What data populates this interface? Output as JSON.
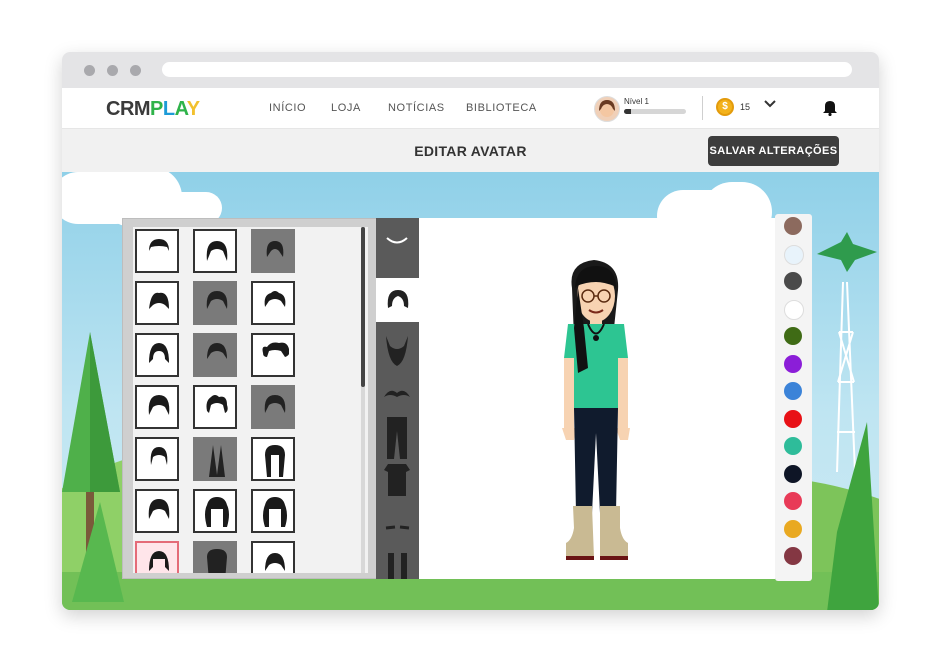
{
  "header": {
    "logo": {
      "crm": "CRM",
      "play_p": "P",
      "play_l": "L",
      "play_a": "A",
      "play_y": "Y"
    },
    "nav": [
      {
        "label": "INÍCIO"
      },
      {
        "label": "LOJA"
      },
      {
        "label": "NOTÍCIAS"
      },
      {
        "label": "BIBLIOTECA"
      }
    ],
    "level": {
      "label": "Nível 1",
      "progress": 0.12
    },
    "coins": "15",
    "icons": {
      "dropdown": "chevron-down-icon",
      "notifications": "bell-icon"
    }
  },
  "editor": {
    "title": "EDITAR AVATAR",
    "save_label": "SALVAR ALTERAÇÕES"
  },
  "categories": [
    "mouth",
    "hair",
    "beard",
    "mustache",
    "pants",
    "shirt",
    "eyebrows",
    "shoes"
  ],
  "hair_options": [
    "short-flat",
    "long-bob",
    "dark-bun",
    "spiky",
    "dark-wavy",
    "messy",
    "bowl",
    "dark-short",
    "pigtails",
    "bob",
    "curly",
    "dark-round",
    "pixie",
    "long-straight-dark",
    "long-straight",
    "layered",
    "long-curly",
    "long-wavy",
    "selected-pink",
    "dark-long",
    "round"
  ],
  "colors": [
    "#8c6a5e",
    "#e8f3fb",
    "#4a4a4a",
    "#ffffff",
    "#3f6b15",
    "#8b1ed8",
    "#3b83d8",
    "#e81116",
    "#2ebc9a",
    "#0e1526",
    "#e83a57",
    "#e9a921",
    "#843743"
  ]
}
